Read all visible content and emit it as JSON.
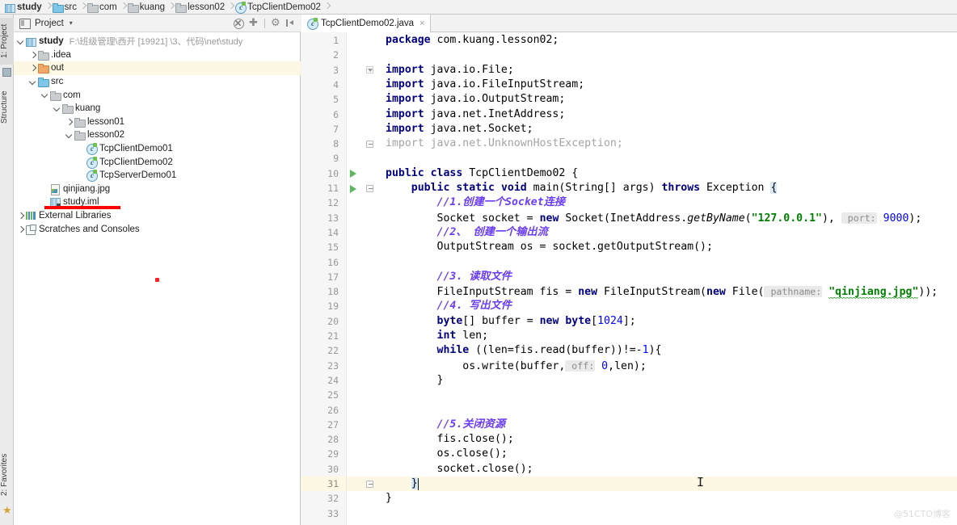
{
  "app": {
    "watermark": "@51CTO博客"
  },
  "breadcrumb": {
    "items": [
      {
        "label": "study",
        "icon": "module-icon"
      },
      {
        "label": "src",
        "icon": "folder-src-icon"
      },
      {
        "label": "com",
        "icon": "folder-icon"
      },
      {
        "label": "kuang",
        "icon": "folder-icon"
      },
      {
        "label": "lesson02",
        "icon": "folder-icon"
      },
      {
        "label": "TcpClientDemo02",
        "icon": "java-class-icon"
      }
    ]
  },
  "toolstrips": {
    "left": [
      {
        "label": "1: Project",
        "icon": "project-icon"
      },
      {
        "label": "2: Favorites",
        "icon": "star-icon"
      }
    ],
    "structure_label": "Structure"
  },
  "project_panel": {
    "title": "Project",
    "caret": "▾",
    "tools": [
      {
        "name": "collapse-all-icon"
      },
      {
        "name": "scroll-from-source-icon"
      },
      {
        "name": "settings-gear-icon"
      },
      {
        "name": "hide-panel-icon"
      }
    ],
    "tree": [
      {
        "label": "study",
        "path": "F:\\班级管理\\西开 [19921] \\3、代码\\net\\study",
        "indent": 0,
        "arrow": "down",
        "icon": "module-icon",
        "bold": true,
        "highlight": false
      },
      {
        "label": ".idea",
        "path": "",
        "indent": 1,
        "arrow": "right",
        "icon": "folder-gray-icon",
        "bold": false,
        "highlight": false
      },
      {
        "label": "out",
        "path": "",
        "indent": 1,
        "arrow": "right",
        "icon": "folder-out-icon",
        "bold": false,
        "highlight": true
      },
      {
        "label": "src",
        "path": "",
        "indent": 1,
        "arrow": "down",
        "icon": "folder-src-icon",
        "bold": false,
        "highlight": false
      },
      {
        "label": "com",
        "path": "",
        "indent": 2,
        "arrow": "down",
        "icon": "folder-gray-icon",
        "bold": false,
        "highlight": false
      },
      {
        "label": "kuang",
        "path": "",
        "indent": 3,
        "arrow": "down",
        "icon": "folder-gray-icon",
        "bold": false,
        "highlight": false
      },
      {
        "label": "lesson01",
        "path": "",
        "indent": 4,
        "arrow": "right",
        "icon": "folder-gray-icon",
        "bold": false,
        "highlight": false
      },
      {
        "label": "lesson02",
        "path": "",
        "indent": 4,
        "arrow": "down",
        "icon": "folder-gray-icon",
        "bold": false,
        "highlight": false
      },
      {
        "label": "TcpClientDemo01",
        "path": "",
        "indent": 5,
        "arrow": "none",
        "icon": "java-class-icon",
        "bold": false,
        "highlight": false
      },
      {
        "label": "TcpClientDemo02",
        "path": "",
        "indent": 5,
        "arrow": "none",
        "icon": "java-class-icon",
        "bold": false,
        "highlight": false
      },
      {
        "label": "TcpServerDemo01",
        "path": "",
        "indent": 5,
        "arrow": "none",
        "icon": "java-class-icon",
        "bold": false,
        "highlight": false
      },
      {
        "label": "qinjiang.jpg",
        "path": "",
        "indent": 2,
        "arrow": "none",
        "icon": "image-file-icon",
        "bold": false,
        "highlight": false
      },
      {
        "label": "study.iml",
        "path": "",
        "indent": 2,
        "arrow": "none",
        "icon": "iml-file-icon",
        "bold": false,
        "highlight": false
      },
      {
        "label": "External Libraries",
        "path": "",
        "indent": 0,
        "arrow": "right",
        "icon": "external-libraries-icon",
        "bold": false,
        "highlight": false
      },
      {
        "label": "Scratches and Consoles",
        "path": "",
        "indent": 0,
        "arrow": "right",
        "icon": "scratches-icon",
        "bold": false,
        "highlight": false
      }
    ],
    "annotations": {
      "red_underline_target": "qinjiang.jpg",
      "red_dot": true
    }
  },
  "editor": {
    "tab": {
      "label": "TcpClientDemo02.java",
      "icon": "java-class-icon",
      "close": "×"
    },
    "current_line": 31,
    "line_count_visible": 33,
    "lines": [
      {
        "n": 1,
        "text": "package com.kuang.lesson02;"
      },
      {
        "n": 2,
        "text": ""
      },
      {
        "n": 3,
        "text": "import java.io.File;"
      },
      {
        "n": 4,
        "text": "import java.io.FileInputStream;"
      },
      {
        "n": 5,
        "text": "import java.io.OutputStream;"
      },
      {
        "n": 6,
        "text": "import java.net.InetAddress;"
      },
      {
        "n": 7,
        "text": "import java.net.Socket;"
      },
      {
        "n": 8,
        "text": "import java.net.UnknownHostException;"
      },
      {
        "n": 9,
        "text": ""
      },
      {
        "n": 10,
        "text": "public class TcpClientDemo02 {"
      },
      {
        "n": 11,
        "text": "    public static void main(String[] args) throws Exception {"
      },
      {
        "n": 12,
        "text": "        //1.创建一个Socket连接"
      },
      {
        "n": 13,
        "text": "        Socket socket = new Socket(InetAddress.getByName(\"127.0.0.1\"),  port: 9000);"
      },
      {
        "n": 14,
        "text": "        //2、 创建一个输出流"
      },
      {
        "n": 15,
        "text": "        OutputStream os = socket.getOutputStream();"
      },
      {
        "n": 16,
        "text": ""
      },
      {
        "n": 17,
        "text": "        //3. 读取文件"
      },
      {
        "n": 18,
        "text": "        FileInputStream fis = new FileInputStream(new File( pathname: \"qinjiang.jpg\"));"
      },
      {
        "n": 19,
        "text": "        //4. 写出文件"
      },
      {
        "n": 20,
        "text": "        byte[] buffer = new byte[1024];"
      },
      {
        "n": 21,
        "text": "        int len;"
      },
      {
        "n": 22,
        "text": "        while ((len=fis.read(buffer))!=-1){"
      },
      {
        "n": 23,
        "text": "            os.write(buffer, off: 0,len);"
      },
      {
        "n": 24,
        "text": "        }"
      },
      {
        "n": 25,
        "text": ""
      },
      {
        "n": 26,
        "text": ""
      },
      {
        "n": 27,
        "text": "        //5.关闭资源"
      },
      {
        "n": 28,
        "text": "        fis.close();"
      },
      {
        "n": 29,
        "text": "        os.close();"
      },
      {
        "n": 30,
        "text": "        socket.close();"
      },
      {
        "n": 31,
        "text": "    }"
      },
      {
        "n": 32,
        "text": "}"
      },
      {
        "n": 33,
        "text": ""
      }
    ],
    "inlay_hints": [
      {
        "line": 13,
        "label": "port:"
      },
      {
        "line": 18,
        "label": "pathname:"
      },
      {
        "line": 23,
        "label": "off:"
      }
    ],
    "gutter_markers": [
      {
        "line": 10,
        "type": "run-class-icon"
      },
      {
        "line": 11,
        "type": "run-method-icon"
      },
      {
        "line": 3,
        "type": "fold-import-icon"
      },
      {
        "line": 8,
        "type": "fold-import-end-icon"
      },
      {
        "line": 11,
        "type": "fold-method-icon"
      },
      {
        "line": 31,
        "type": "fold-method-end-icon"
      }
    ]
  },
  "colors": {
    "keyword": "#000080",
    "string": "#008000",
    "number": "#0000ff",
    "comment": "#6a3df5",
    "unused": "#a4a4a4",
    "current_line_bg": "#fdf8e3",
    "annotation_red": "#fe0000",
    "run_green": "#5cb85c"
  }
}
